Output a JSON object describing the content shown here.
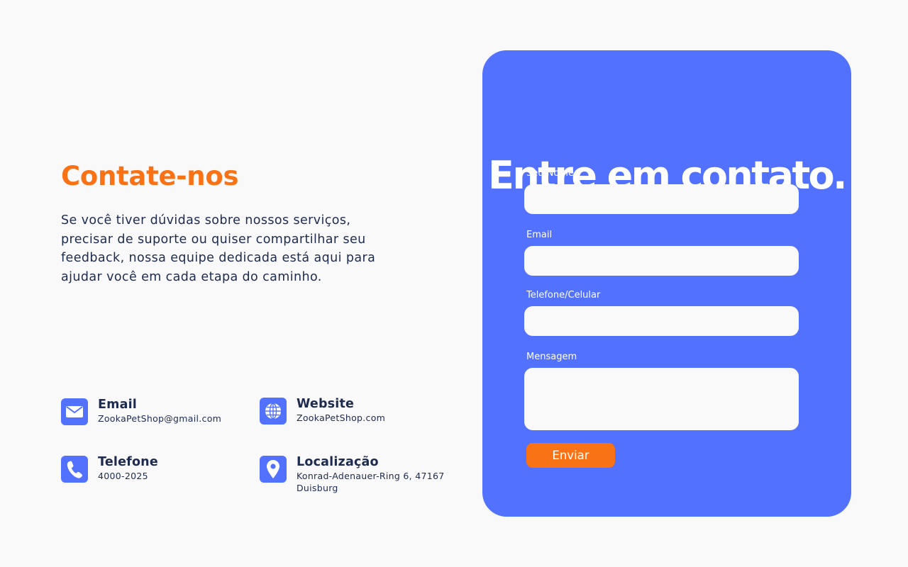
{
  "contact": {
    "heading": "Contate-nos",
    "description": "Se você tiver dúvidas sobre nossos serviços, precisar de suporte ou quiser compartilhar seu feedback, nossa equipe dedicada está aqui para ajudar você em cada etapa do caminho."
  },
  "info": {
    "email": {
      "title": "Email",
      "value": "ZookaPetShop@gmail.com",
      "icon": "envelope-icon"
    },
    "website": {
      "title": "Website",
      "value": "ZookaPetShop.com",
      "icon": "globe-icon"
    },
    "phone": {
      "title": "Telefone",
      "value": "4000-2025",
      "icon": "phone-icon"
    },
    "location": {
      "title": "Localização",
      "value_line1": "Konrad-Adenauer-Ring 6, 47167",
      "value_line2": "Duisburg",
      "icon": "map-pin-icon"
    }
  },
  "form": {
    "title": "Entre em contato.",
    "name_label": "Seu Nome",
    "email_label": "Email",
    "phone_label": "Telefone/Celular",
    "message_label": "Mensagem",
    "submit_label": "Enviar"
  },
  "colors": {
    "accent_orange": "#f97316",
    "card_blue": "#5271ff",
    "text_dark": "#1d2b4f",
    "background": "#f9f9f9"
  }
}
